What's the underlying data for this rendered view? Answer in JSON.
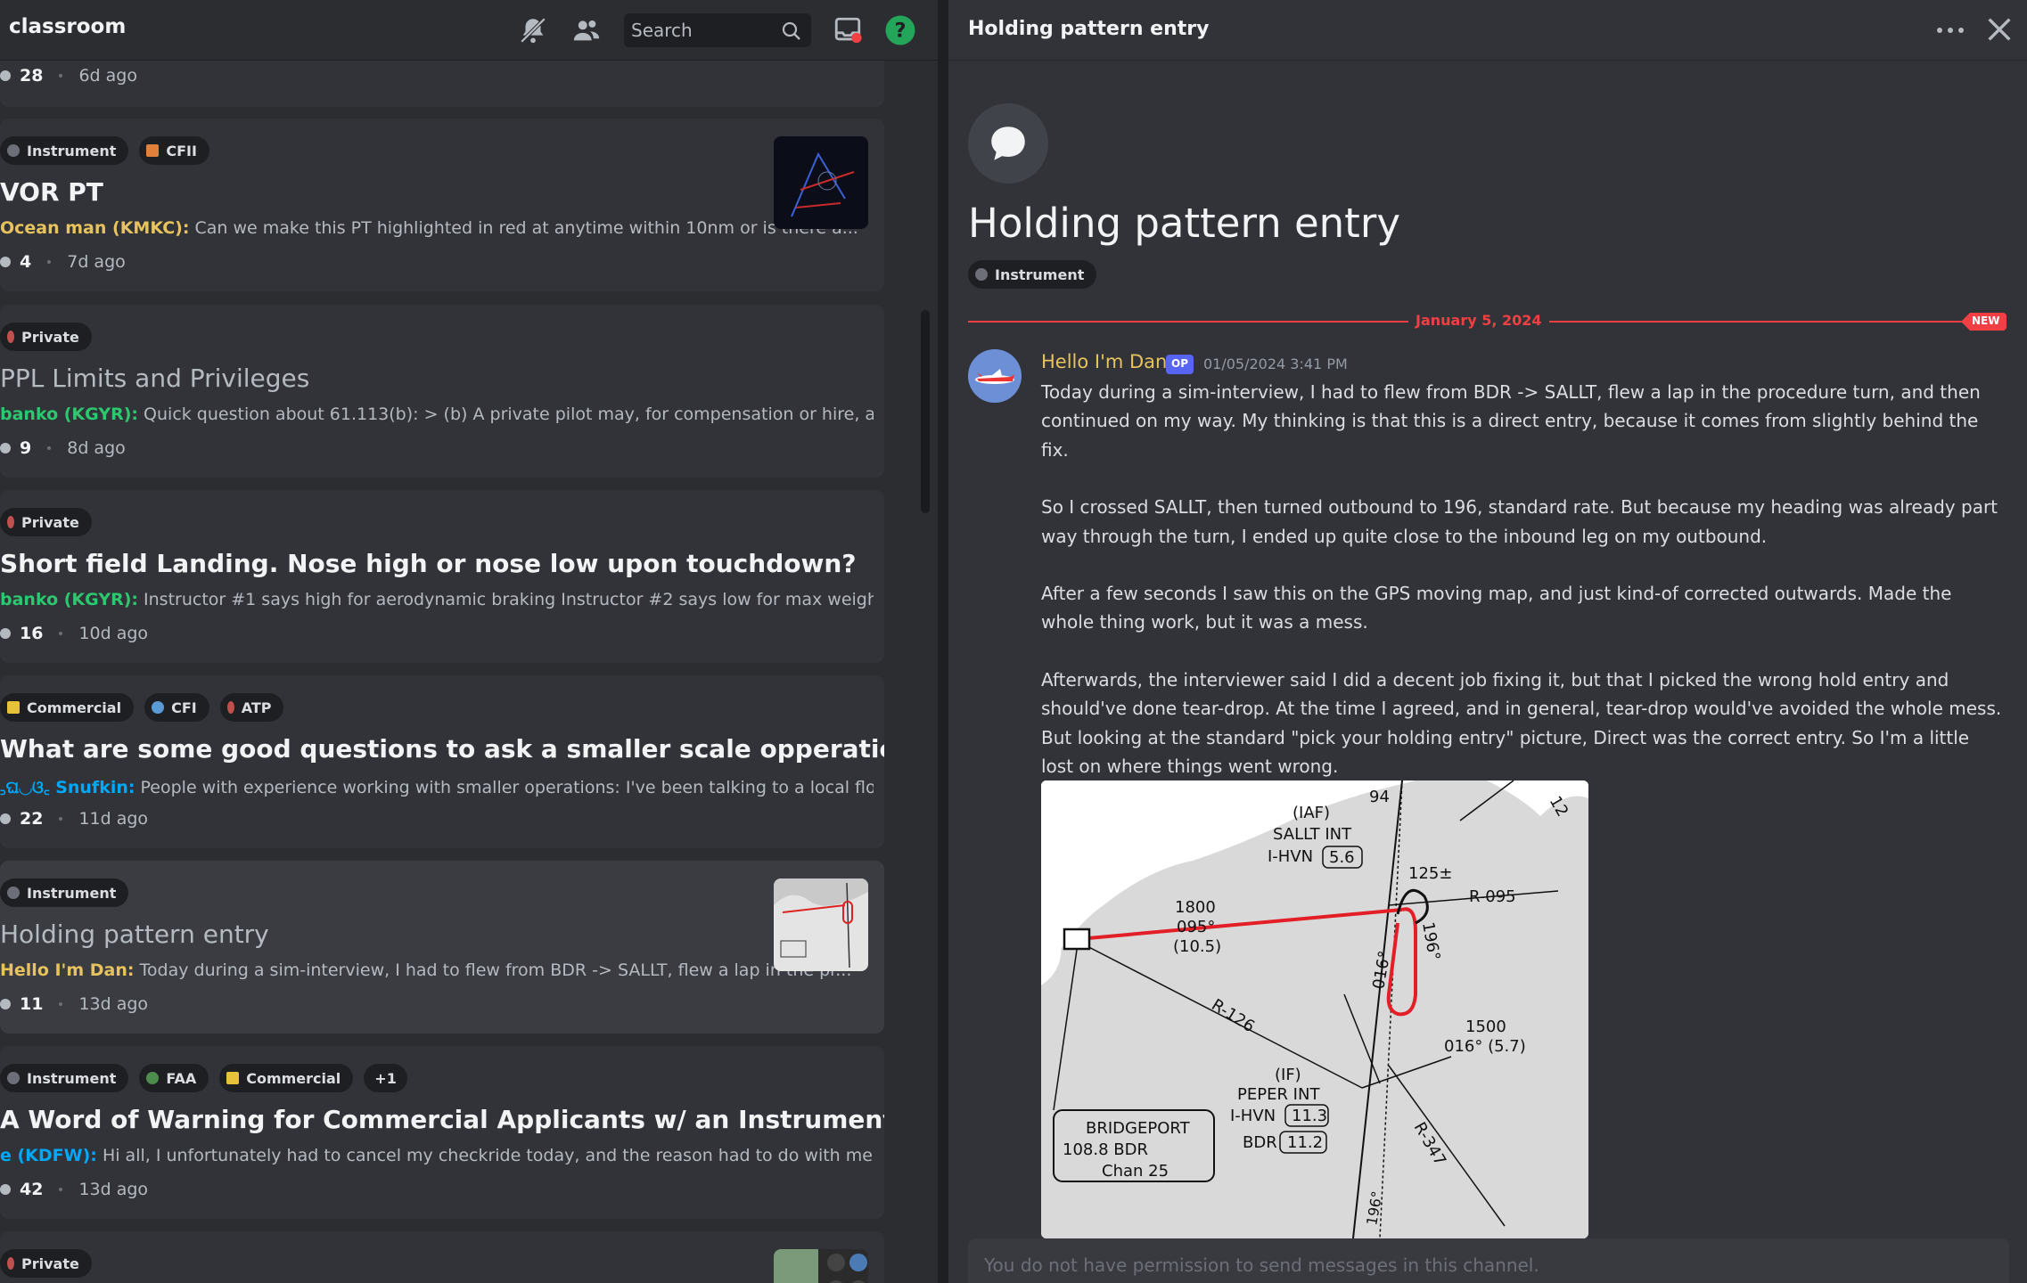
{
  "header": {
    "channel_name": "classroom",
    "search_placeholder": "Search"
  },
  "colors": {
    "accent": "#5865f2",
    "new_red": "#f23f43",
    "author_yellow": "#e7c35d",
    "author_green": "#2dc770",
    "author_blue": "#00a8fc",
    "help_green": "#23a55a"
  },
  "posts": [
    {
      "partial_meta": {
        "count": "28",
        "age": "6d ago"
      }
    },
    {
      "tags": [
        "Instrument",
        "CFII"
      ],
      "title": "VOR PT",
      "author": "Ocean man (KMKC):",
      "preview": " Can we make this PT highlighted in red at anytime within 10nm or is there a...",
      "count": "4",
      "age": "7d ago"
    },
    {
      "tags": [
        "Private"
      ],
      "title": "PPL Limits and Privileges",
      "author": "banko (KGYR):",
      "preview": " Quick question about 61.113(b): > (b) A private pilot may, for compensation or hire, act as pilot i...",
      "count": "9",
      "age": "8d ago"
    },
    {
      "tags": [
        "Private"
      ],
      "title": "Short field Landing. Nose high or nose low upon touchdown?",
      "author": "banko (KGYR):",
      "preview": " Instructor #1 says high for aerodynamic braking Instructor #2 says low for max weight on the ...",
      "count": "16",
      "age": "10d ago"
    },
    {
      "tags": [
        "Commercial",
        "CFI",
        "ATP"
      ],
      "title": "What are some good questions to ask a smaller scale opperation",
      "author": "꜆ଘ◡ଓ꜀ Snufkin:",
      "preview": " People with experience working with smaller operations: I've been talking to a local floa...",
      "count": "22",
      "age": "11d ago"
    },
    {
      "tags": [
        "Instrument"
      ],
      "title": "Holding pattern entry",
      "author": "Hello I'm Dan:",
      "preview": " Today during a sim-interview, I had to flew from BDR -> SALLT, flew a lap in the pr...",
      "count": "11",
      "age": "13d ago"
    },
    {
      "tags": [
        "Instrument",
        "FAA",
        "Commercial",
        "+1"
      ],
      "title": "A Word of Warning for Commercial Applicants w/ an Instrument Rating",
      "author": "e (KDFW):",
      "preview": " Hi all, I unfortunately had to cancel my checkride today, and the reason had to do with me electing...",
      "count": "42",
      "age": "13d ago"
    },
    {
      "tags": [
        "Private"
      ]
    }
  ],
  "thread": {
    "header_title": "Holding pattern entry",
    "title": "Holding pattern entry",
    "tag": "Instrument",
    "date_divider": "January 5, 2024",
    "new_badge": "NEW",
    "author": "Hello I'm Dan",
    "op_badge": "OP",
    "timestamp": "01/05/2024 3:41 PM",
    "paragraphs": [
      "Today during a sim-interview, I had to flew from BDR -> SALLT, flew a lap in the procedure turn, and then continued on my way.  My thinking is that this is a direct entry, because it comes from slightly behind the fix.",
      "So I crossed SALLT, then turned outbound to 196, standard rate.  But because my heading was already part way through the turn, I ended up quite close to the inbound leg on my outbound.",
      "After a few seconds I saw this on the GPS moving map, and just kind-of corrected outwards.  Made the whole thing work, but it was a mess.",
      "Afterwards, the interviewer said I did a decent job fixing it, but that I picked the wrong hold entry and should've done tear-drop.  At the time I agreed, and in general, tear-drop would've avoided the whole mess.  But looking at the standard \"pick your holding entry\" picture, Direct was the correct entry.  So I'm a little lost on where things went wrong."
    ],
    "chart_labels": {
      "iaf": "(IAF)",
      "sallt_int": "SALLT INT",
      "ihvn_top": "I-HVN",
      "ihvn_top_box": "5.6",
      "alt1": "1800",
      "hdg1": "095°",
      "dist1": "(10.5)",
      "r095": "R-095",
      "r126": "R-126",
      "r347": "R-347",
      "alt2": "125±",
      "n94": "94",
      "n12": "12",
      "h016": "016°",
      "h196": "196°",
      "alt3": "1500",
      "leg3": "016° (5.7)",
      "if": "(IF)",
      "peper_int": "PEPER INT",
      "ihvn_bot": "I-HVN",
      "ihvn_bot_box": "11.3",
      "bdr": "BDR",
      "bdr_box": "11.2",
      "vortac_name": "BRIDGEPORT",
      "vortac_freq": "108.8  BDR",
      "vortac_chan": "Chan 25",
      "bottom196": "196°"
    }
  },
  "composer": {
    "placeholder": "You do not have permission to send messages in this channel."
  }
}
